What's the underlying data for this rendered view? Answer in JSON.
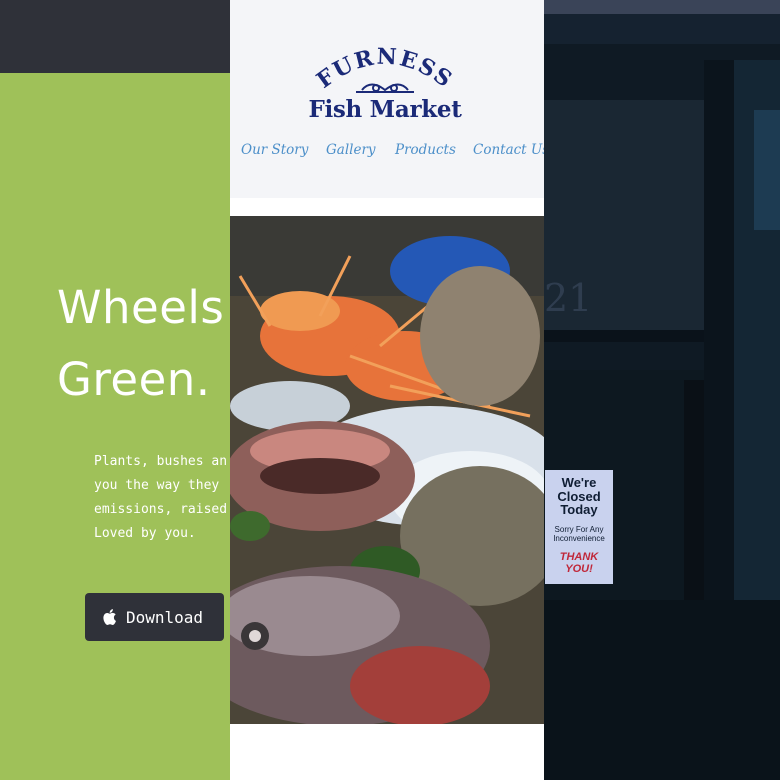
{
  "left": {
    "hero_title": "Wheels\nGreen.",
    "hero_text": "Plants, bushes an\nyou the way they\nemissions, raised\nLoved by you.",
    "download_label": "Download",
    "download_icon": "apple-icon",
    "colors": {
      "topbar": "#2f3139",
      "green": "#9fc159",
      "button": "#2f3139"
    }
  },
  "middle": {
    "logo": {
      "line1": "FURNESS",
      "line2": "Fish Market"
    },
    "nav": [
      {
        "label": "Our Story"
      },
      {
        "label": "Gallery"
      },
      {
        "label": "Products"
      },
      {
        "label": "Contact Us"
      }
    ],
    "colors": {
      "logo": "#1b2a78",
      "nav": "#4c8fc9",
      "header_bg": "#f4f5f8"
    }
  },
  "right": {
    "door_number": "21",
    "sign": {
      "line1": "We're",
      "line2": "Closed",
      "line3": "Today",
      "line4": "Sorry For Any",
      "line5": "Inconvenience",
      "line6": "THANK YOU!"
    }
  }
}
